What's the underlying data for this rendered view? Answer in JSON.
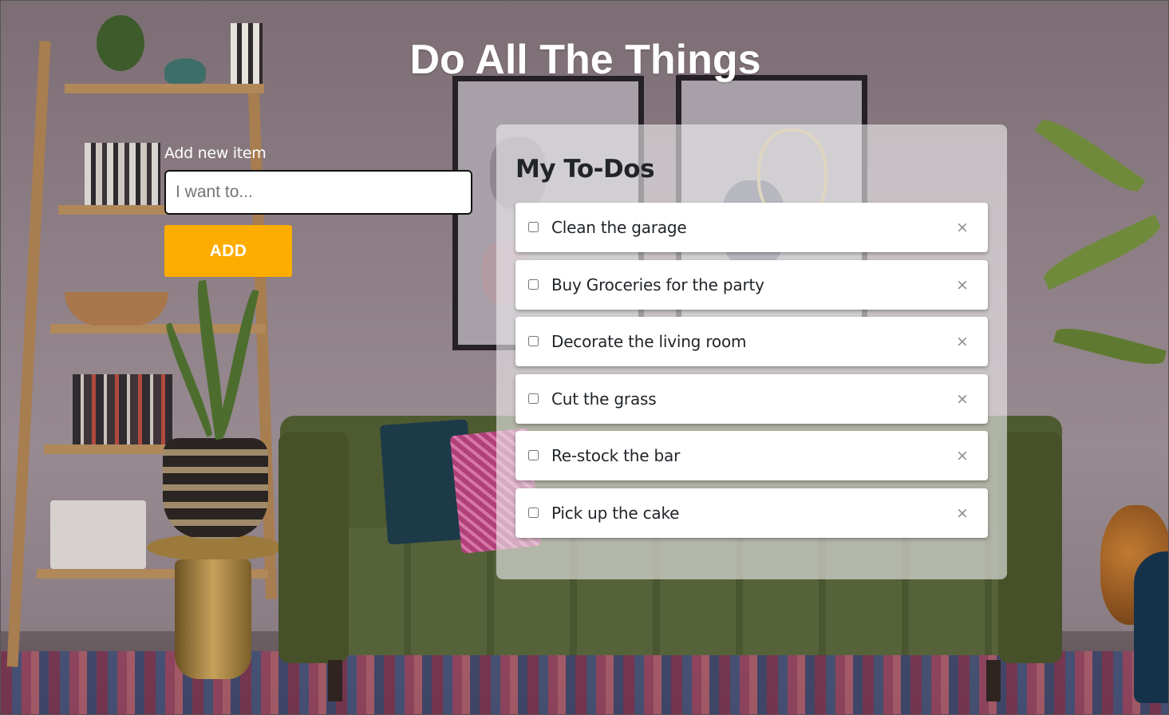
{
  "app": {
    "title": "Do All The Things"
  },
  "add_form": {
    "label": "Add new item",
    "input_value": "",
    "input_placeholder": "I want to...",
    "button_label": "ADD",
    "button_color": "#fdac00"
  },
  "todo_panel": {
    "heading": "My To-Dos",
    "items": [
      {
        "label": "Clean the garage",
        "checked": false,
        "delete_icon": "close-icon",
        "delete_glyph": "×"
      },
      {
        "label": "Buy Groceries for the party",
        "checked": false,
        "delete_icon": "close-icon",
        "delete_glyph": "×"
      },
      {
        "label": "Decorate the living room",
        "checked": false,
        "delete_icon": "close-icon",
        "delete_glyph": "×"
      },
      {
        "label": "Cut the grass",
        "checked": false,
        "delete_icon": "close-icon",
        "delete_glyph": "×"
      },
      {
        "label": "Re-stock the bar",
        "checked": false,
        "delete_icon": "close-icon",
        "delete_glyph": "×"
      },
      {
        "label": "Pick up the cake",
        "checked": false,
        "delete_icon": "close-icon",
        "delete_glyph": "×"
      }
    ]
  }
}
